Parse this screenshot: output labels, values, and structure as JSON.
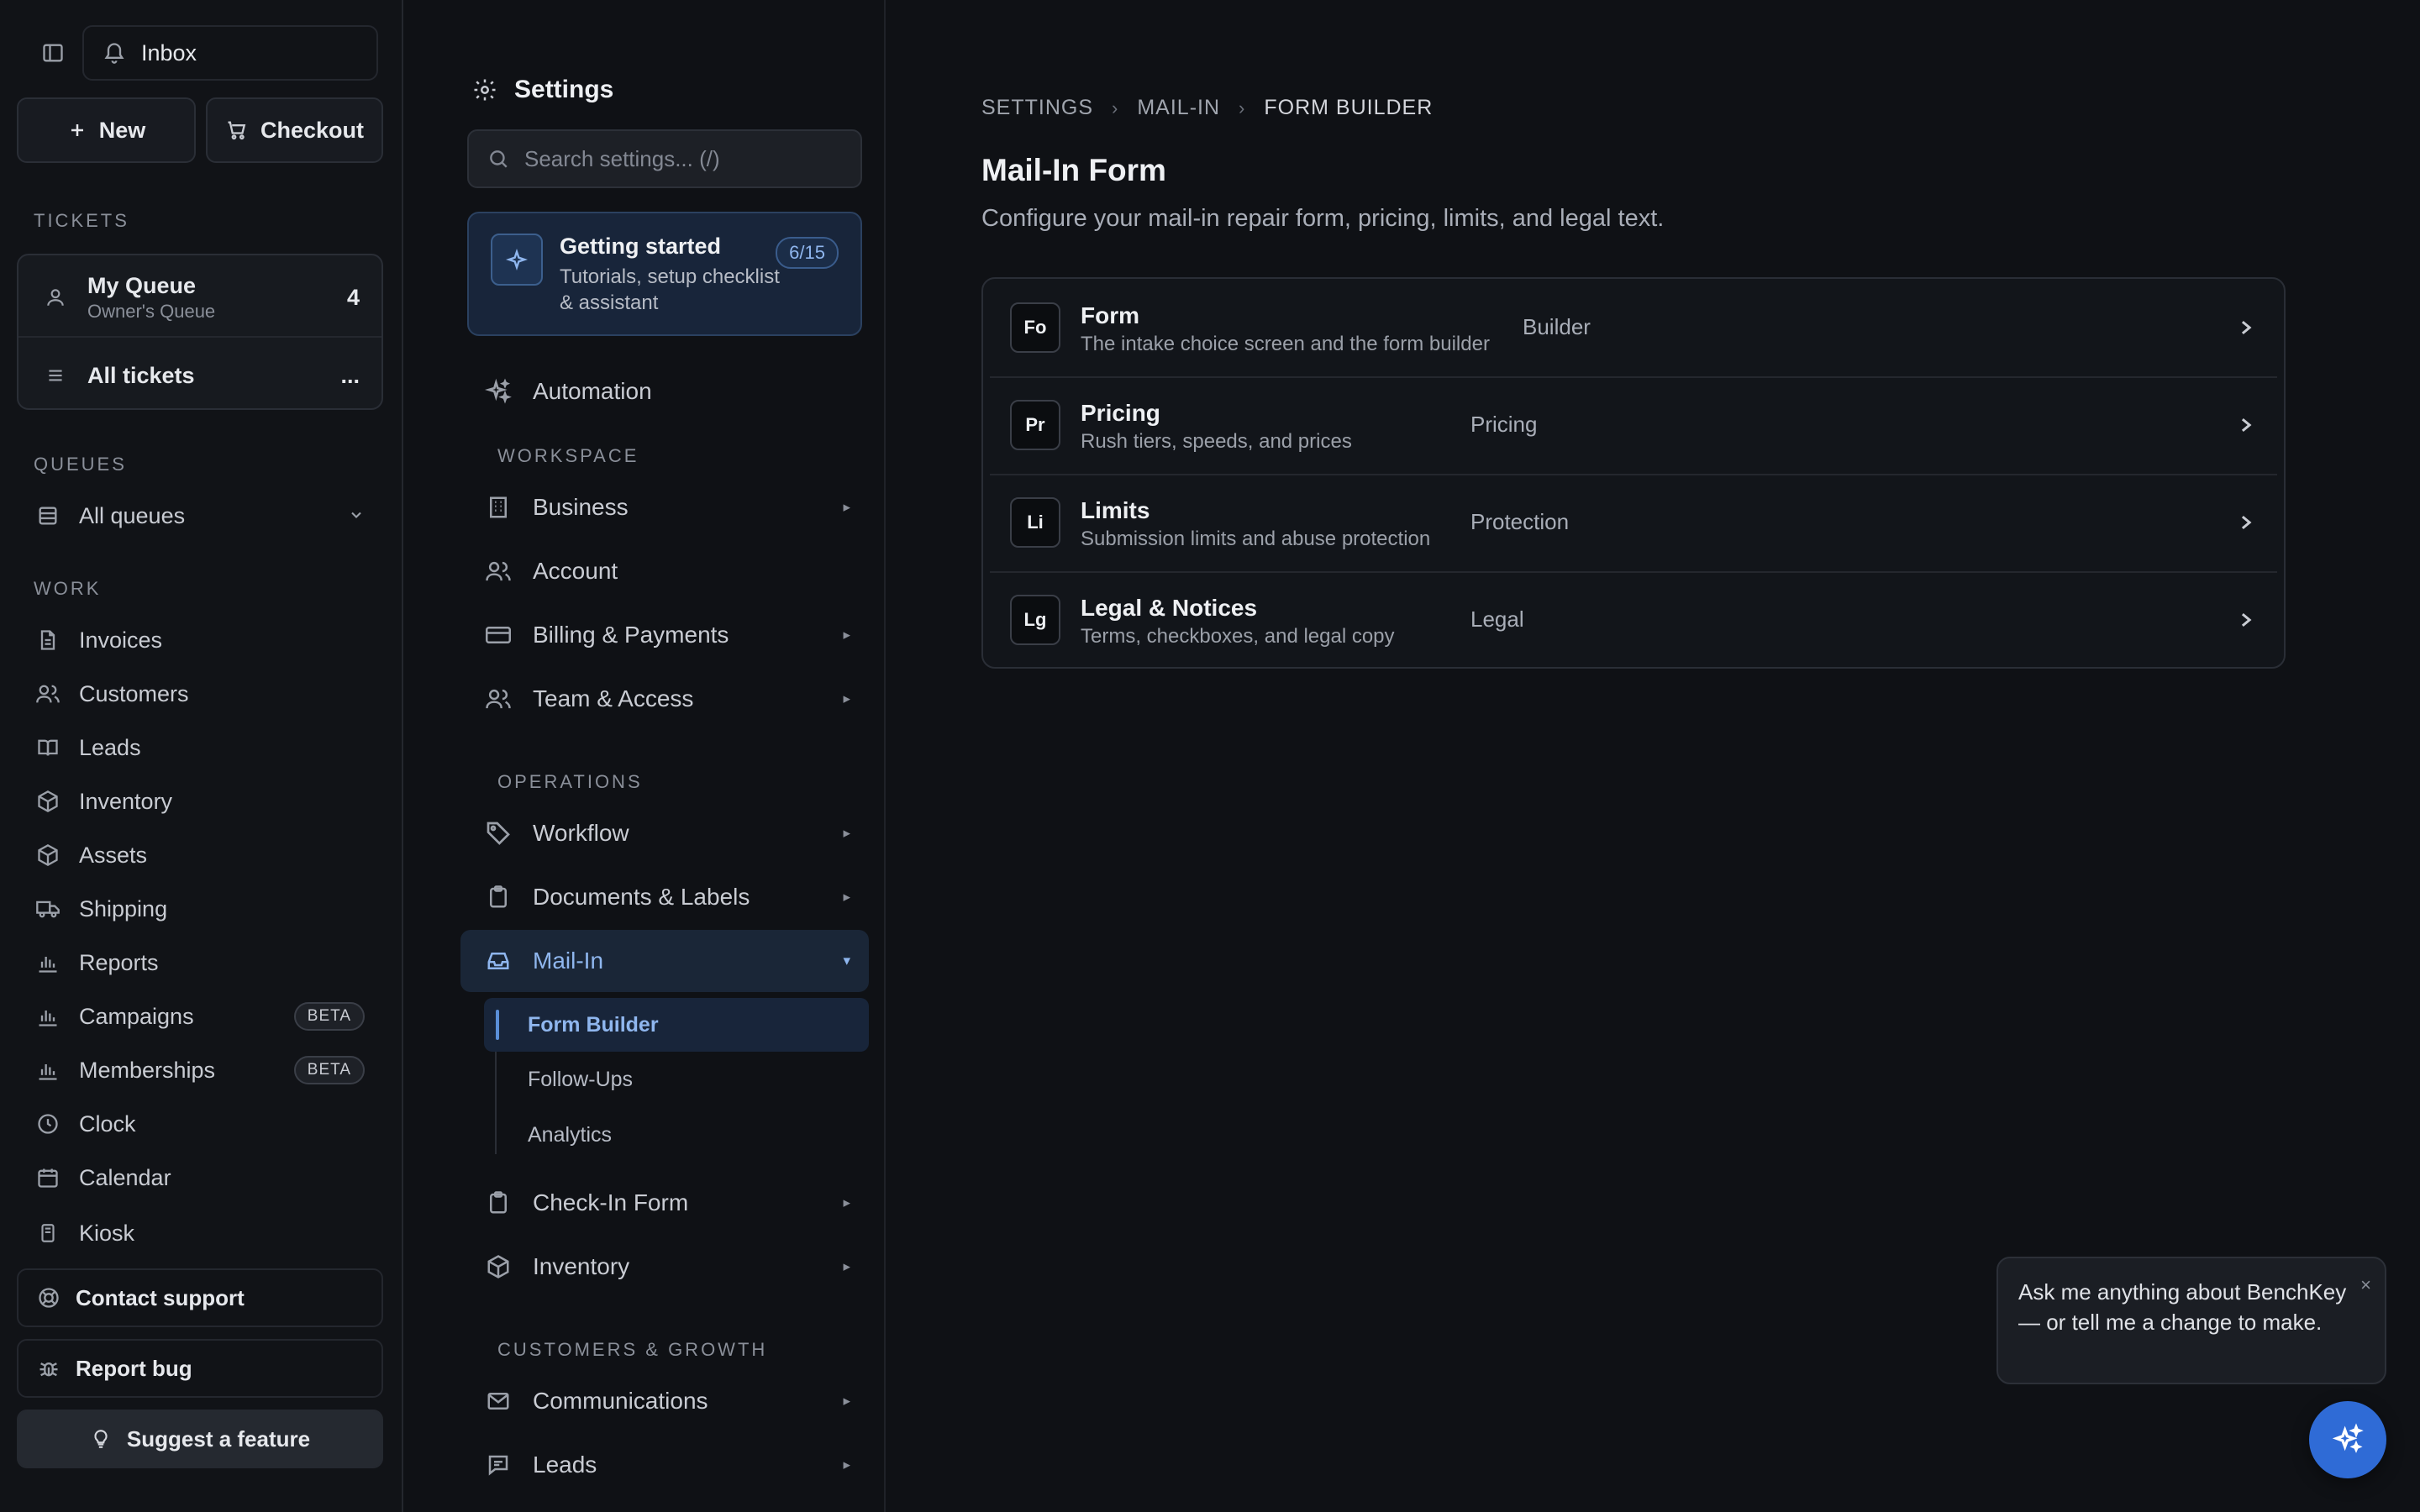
{
  "sidebar": {
    "inbox_label": "Inbox",
    "new_label": "New",
    "checkout_label": "Checkout",
    "tickets_heading": "TICKETS",
    "my_queue": {
      "title": "My Queue",
      "subtitle": "Owner's Queue",
      "count": "4"
    },
    "all_tickets": {
      "title": "All tickets",
      "more": "..."
    },
    "queues_heading": "QUEUES",
    "all_queues": "All queues",
    "work_heading": "WORK",
    "work_items": [
      {
        "label": "Invoices",
        "icon": "file-icon"
      },
      {
        "label": "Customers",
        "icon": "users-icon"
      },
      {
        "label": "Leads",
        "icon": "book-icon"
      },
      {
        "label": "Inventory",
        "icon": "box-icon"
      },
      {
        "label": "Assets",
        "icon": "box-icon"
      },
      {
        "label": "Shipping",
        "icon": "truck-icon"
      },
      {
        "label": "Reports",
        "icon": "bar-chart-icon"
      },
      {
        "label": "Campaigns",
        "icon": "bar-chart-icon",
        "badge": "BETA"
      },
      {
        "label": "Memberships",
        "icon": "bar-chart-icon",
        "badge": "BETA"
      },
      {
        "label": "Clock",
        "icon": "clock-icon"
      },
      {
        "label": "Calendar",
        "icon": "calendar-icon"
      },
      {
        "label": "Kiosk",
        "icon": "tablet-icon"
      }
    ],
    "contact_support": "Contact support",
    "report_bug": "Report bug",
    "suggest_feature": "Suggest a feature"
  },
  "settings_nav": {
    "title": "Settings",
    "search_placeholder": "Search settings... (/)",
    "getting_started": {
      "title": "Getting started",
      "subtitle": "Tutorials, setup checklist & assistant",
      "progress": "6/15"
    },
    "automation": "Automation",
    "workspace_heading": "WORKSPACE",
    "business": "Business",
    "account": "Account",
    "billing": "Billing & Payments",
    "team": "Team & Access",
    "operations_heading": "OPERATIONS",
    "workflow": "Workflow",
    "documents": "Documents & Labels",
    "mail_in": "Mail-In",
    "mail_in_children": [
      "Form Builder",
      "Follow-Ups",
      "Analytics"
    ],
    "check_in": "Check-In Form",
    "inventory": "Inventory",
    "growth_heading": "CUSTOMERS & GROWTH",
    "communications": "Communications",
    "leads": "Leads",
    "collapsed_arrow": "▸",
    "expanded_arrow": "▾"
  },
  "main": {
    "breadcrumb": [
      "SETTINGS",
      "MAIL-IN",
      "FORM BUILDER"
    ],
    "breadcrumb_sep": "›",
    "title": "Mail-In Form",
    "description": "Configure your mail-in repair form, pricing, limits, and legal text.",
    "rows": [
      {
        "abbr": "Fo",
        "title": "Form",
        "subtitle": "The intake choice screen and the form builder",
        "category": "Builder"
      },
      {
        "abbr": "Pr",
        "title": "Pricing",
        "subtitle": "Rush tiers, speeds, and prices",
        "category": "Pricing"
      },
      {
        "abbr": "Li",
        "title": "Limits",
        "subtitle": "Submission limits and abuse protection",
        "category": "Protection"
      },
      {
        "abbr": "Lg",
        "title": "Legal & Notices",
        "subtitle": "Terms, checkboxes, and legal copy",
        "category": "Legal"
      }
    ]
  },
  "assistant": {
    "tooltip": "Ask me anything about BenchKey — or tell me a change to make.",
    "close": "×"
  },
  "colors": {
    "background": "#0f1115",
    "accent": "#2f6bd6",
    "active_text": "#8fb6ee"
  }
}
